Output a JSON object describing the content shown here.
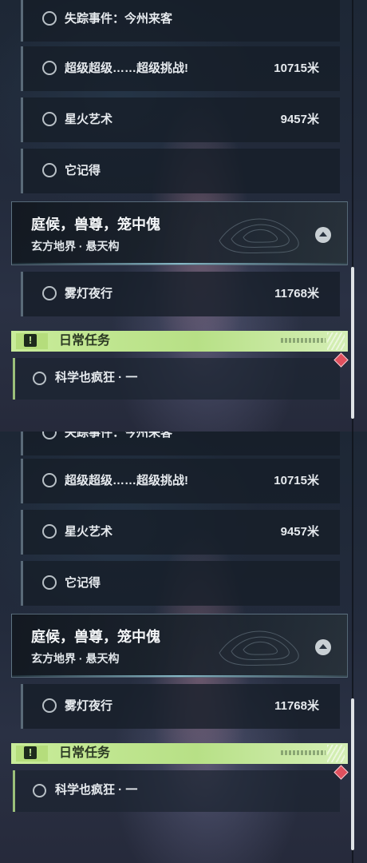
{
  "missions": [
    {
      "title": "失踪事件：今州来客",
      "distance": ""
    },
    {
      "title": "超级超级……超级挑战!",
      "distance": "10715米"
    },
    {
      "title": "星火艺术",
      "distance": "9457米"
    },
    {
      "title": "它记得",
      "distance": ""
    }
  ],
  "region": {
    "title": "庭候，兽尊，笼中傀",
    "subtitle": "玄方地界 · 悬天构"
  },
  "region_missions": [
    {
      "title": "雾灯夜行",
      "distance": "11768米"
    }
  ],
  "daily": {
    "label": "日常任务",
    "task": "科学也疯狂 · 一",
    "icon_glyph": "!"
  },
  "colors": {
    "daily_accent": "#c9ec9a",
    "marker": "#e0505e"
  }
}
